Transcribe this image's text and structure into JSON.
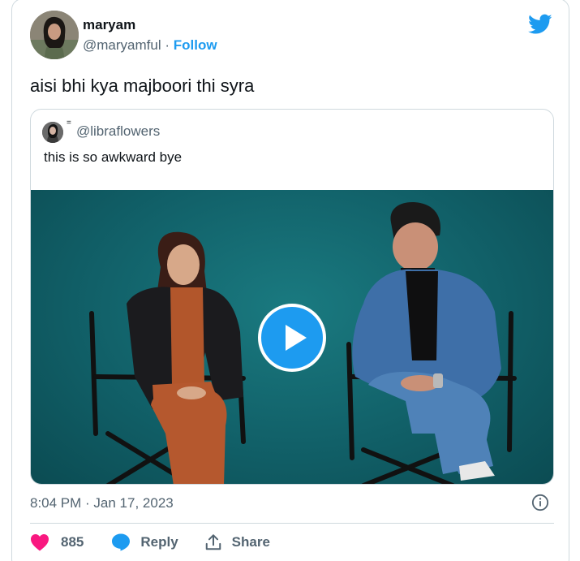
{
  "author": {
    "name": "maryam",
    "handle": "@maryamful",
    "separator": "·",
    "follow_label": "Follow"
  },
  "tweet": {
    "text": "aisi bhi kya majboori thi syra"
  },
  "quoted": {
    "mark": "=",
    "handle": "@libraflowers",
    "text": "this is so awkward bye"
  },
  "timestamp": "8:04 PM · Jan 17, 2023",
  "actions": {
    "like_count": "885",
    "reply_label": "Reply",
    "share_label": "Share"
  },
  "colors": {
    "accent": "#1d9bf0",
    "like": "#f91880",
    "secondary_text": "#536471",
    "border": "#cfd9de",
    "video_bg": "#116068"
  },
  "icons": [
    "twitter-bird-icon",
    "info-icon",
    "heart-icon",
    "reply-bubble-icon",
    "share-icon",
    "play-icon"
  ]
}
